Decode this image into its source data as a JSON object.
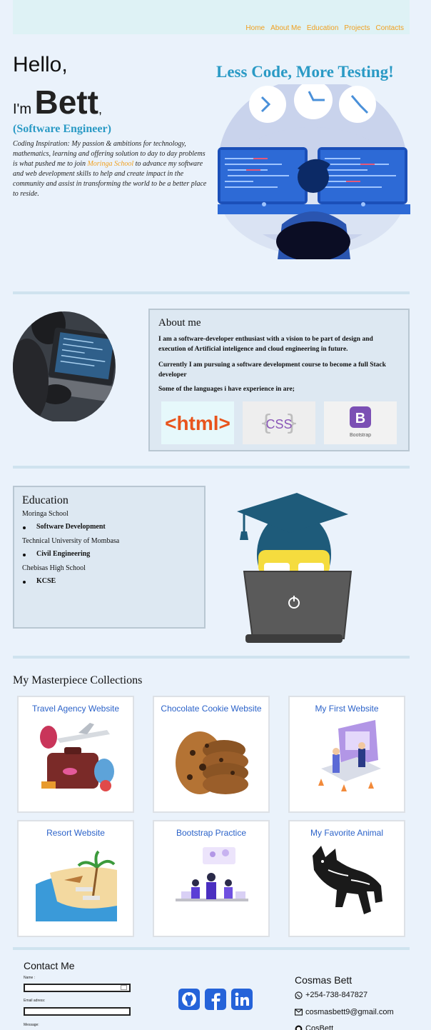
{
  "nav": {
    "items": [
      "Home",
      "About Me",
      "Education",
      "Projects",
      "Contacts"
    ]
  },
  "hero": {
    "greeting": "Hello,",
    "im": "I'm",
    "name": "Bett",
    "comma": ",",
    "role": "(Software Engineer)",
    "bio_part1": "Coding Inspiration: My passion & ambitions for technology, mathematics, learning and offering solution to day to day problems is what pushed me to join ",
    "bio_school": "Moringa School",
    "bio_part2": " to advance my software and web development skills to help and create impact in the community and assist in transforming the world to be a better place to reside.",
    "tagline": "Less Code, More Testing!"
  },
  "about": {
    "title": "About me",
    "p1": "I am a software-developer enthusiast with a vision to be part of design and execution of Artificial inteligence and cloud engineering in future.",
    "p2": "Currently I am pursuing a software development course to become a full Stack developer",
    "p3": "Some of the languages i have experience in are;",
    "languages": [
      "<html>",
      "CSS",
      "Bootstrap"
    ]
  },
  "education": {
    "title": "Education",
    "entries": [
      {
        "institution": "Moringa School",
        "qualification": "Software Development"
      },
      {
        "institution": "Technical University of Mombasa",
        "qualification": "Civil Engineering"
      },
      {
        "institution": "Chebisas High School",
        "qualification": "KCSE"
      }
    ]
  },
  "projects": {
    "title": "My Masterpiece Collections",
    "items": [
      {
        "label": "Travel Agency Website",
        "icon": "travel-luggage-image"
      },
      {
        "label": "Chocolate Cookie Website",
        "icon": "cookies-image"
      },
      {
        "label": "My First Website",
        "icon": "team-illustration-image"
      },
      {
        "label": "Resort Website",
        "icon": "beach-resort-image"
      },
      {
        "label": "Bootstrap Practice",
        "icon": "meeting-illustration-image"
      },
      {
        "label": "My Favorite Animal",
        "icon": "dog-drawing-image"
      }
    ]
  },
  "contact": {
    "title": "Contact Me",
    "name_label": "Name :",
    "email_label": "Email adress:",
    "message_label": "Message:",
    "person": "Cosmas Bett",
    "phone": "+254-738-847827",
    "email": "cosmasbett9@gmail.com",
    "github": "CosBett",
    "social": [
      "github-icon",
      "facebook-icon",
      "linkedin-icon"
    ]
  },
  "colors": {
    "accent_blue": "#2a9ac5",
    "nav_orange": "#f0a020",
    "link_blue": "#2c63c9",
    "background": "#eaf2fb"
  }
}
